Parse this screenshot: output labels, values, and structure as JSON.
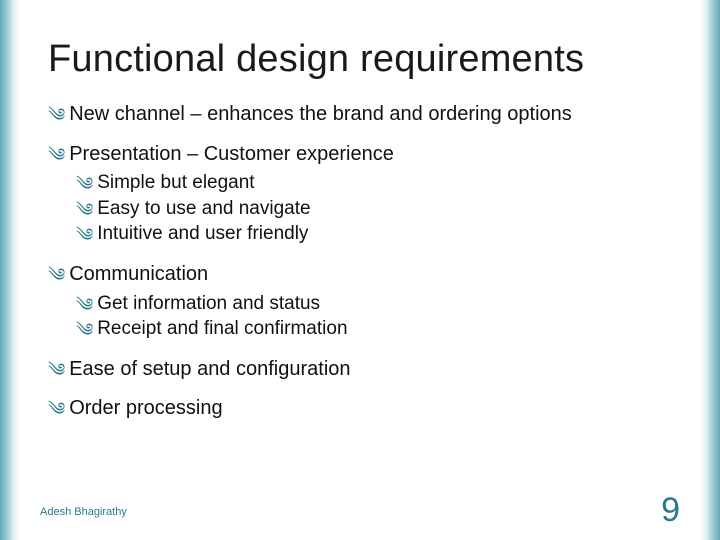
{
  "title": "Functional design requirements",
  "bullets": {
    "b1": "New channel – enhances the brand and ordering options",
    "b2": "Presentation – Customer experience",
    "b2_sub": {
      "s1": "Simple but elegant",
      "s2": "Easy to use and navigate",
      "s3": "Intuitive and user friendly"
    },
    "b3": "Communication",
    "b3_sub": {
      "s1": "Get information and status",
      "s2": "Receipt and final confirmation"
    },
    "b4": "Ease of setup and configuration",
    "b5": "Order processing"
  },
  "footer": {
    "author": "Adesh Bhagirathy",
    "page": "9"
  },
  "colors": {
    "accent": "#2a7a8a"
  }
}
